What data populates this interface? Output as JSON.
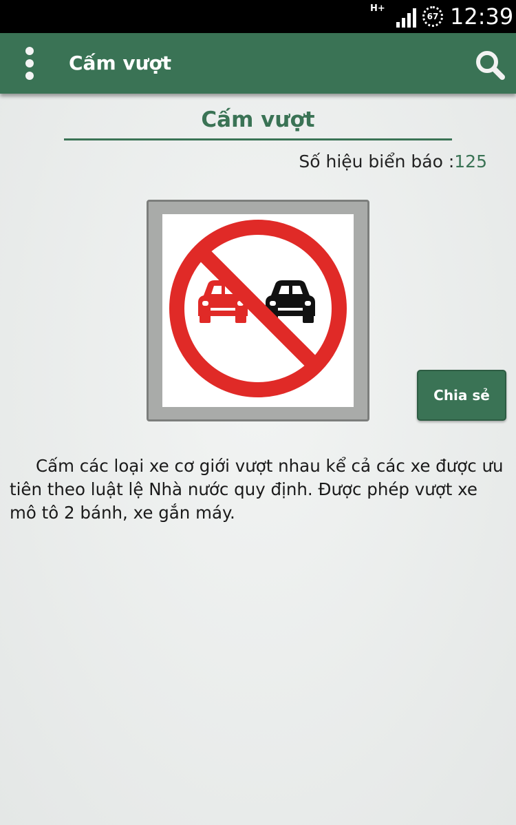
{
  "status_bar": {
    "network": "H+",
    "battery": "67",
    "time": "12:39"
  },
  "app_bar": {
    "title": "Cấm vượt"
  },
  "content": {
    "heading": "Cấm vượt",
    "sign_number_label": "Số hiệu biển báo :",
    "sign_number_value": "125",
    "share_label": "Chia sẻ",
    "description": "Cấm các loại xe cơ giới vượt nhau kể cả các xe được ưu tiên theo luật lệ Nhà nước quy định. Được phép vượt xe mô tô 2 bánh, xe gắn máy."
  },
  "colors": {
    "accent": "#3a7355",
    "sign_red": "#e02a27",
    "background": "#e8ebea"
  },
  "icons": [
    "overflow-menu-icon",
    "search-icon",
    "signal-icon",
    "battery-icon"
  ]
}
